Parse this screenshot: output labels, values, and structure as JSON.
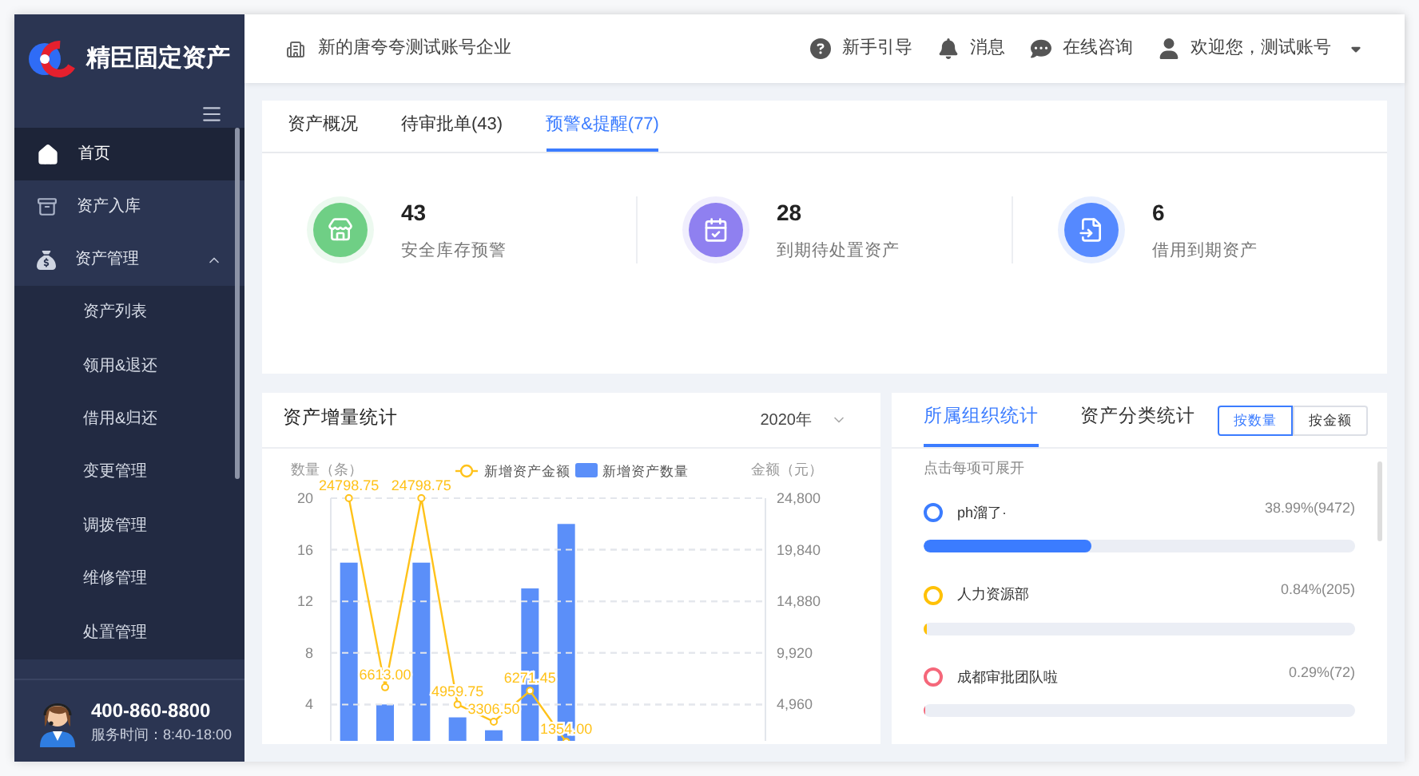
{
  "brand": {
    "name": "精臣固定资产"
  },
  "sidebar": {
    "items": [
      {
        "kind": "item",
        "label": "首页",
        "selected": true
      },
      {
        "kind": "item",
        "label": "资产入库",
        "selected": false
      },
      {
        "kind": "group",
        "label": "资产管理",
        "selected": false,
        "expanded": true,
        "children": [
          {
            "label": "资产列表",
            "selected": false
          },
          {
            "label": "领用&退还",
            "selected": false
          },
          {
            "label": "借用&归还",
            "selected": false
          },
          {
            "label": "变更管理",
            "selected": false
          },
          {
            "label": "调拨管理",
            "selected": false
          },
          {
            "label": "维修管理",
            "selected": false
          },
          {
            "label": "处置管理",
            "selected": false
          }
        ]
      }
    ],
    "support": {
      "phone": "400-860-8800",
      "hours": "服务时间：8:40-18:00"
    }
  },
  "header": {
    "company": "新的唐夸夸测试账号企业",
    "actions": [
      {
        "kind": "help",
        "label": "新手引导"
      },
      {
        "kind": "bell",
        "label": "消息"
      },
      {
        "kind": "chat",
        "label": "在线咨询"
      },
      {
        "kind": "user",
        "label": "欢迎您，测试账号"
      }
    ]
  },
  "tabs": [
    {
      "label": "资产概况",
      "selected": false
    },
    {
      "label": "待审批单(43)",
      "selected": false
    },
    {
      "label": "预警&提醒(77)",
      "selected": true
    }
  ],
  "stats": [
    {
      "kind": "stock",
      "value": "43",
      "label": "安全库存预警",
      "color": "#6fcf85"
    },
    {
      "kind": "calendar",
      "value": "28",
      "label": "到期待处置资产",
      "color": "#8f80f0"
    },
    {
      "kind": "borrow",
      "value": "6",
      "label": "借用到期资产",
      "color": "#5589ff"
    }
  ],
  "growth_panel": {
    "title": "资产增量统计",
    "year": "2020年",
    "layers": [
      {
        "chart_data": {
          "type": "bar",
          "categories": [
            null,
            null,
            null,
            null,
            null,
            null,
            null,
            null,
            null,
            null,
            null,
            null
          ],
          "ylabel": "数量（条）",
          "ylim": [
            0,
            20
          ],
          "yticks": [
            4,
            8,
            12,
            16,
            20
          ],
          "grid": true,
          "legend": "top",
          "series": [
            {
              "name": "新增资产数量",
              "color": "#5b8ff9",
              "values": [
                15,
                4,
                15,
                3,
                2,
                13,
                18,
                null,
                null,
                null,
                null,
                null
              ]
            }
          ]
        }
      },
      {
        "chart_data": {
          "type": "line",
          "categories": [
            null,
            null,
            null,
            null,
            null,
            null,
            null,
            null,
            null,
            null,
            null,
            null
          ],
          "ylabel": "金额（元）",
          "ylim": [
            0,
            24800
          ],
          "yticks": [
            {
              "value": 4960,
              "label": "4,960"
            },
            {
              "value": 9920,
              "label": "9,920"
            },
            {
              "value": 14880,
              "label": "14,880"
            },
            {
              "value": 19840,
              "label": "19,840"
            },
            {
              "value": 24800,
              "label": "24,800"
            }
          ],
          "grid": true,
          "legend": "top",
          "series": [
            {
              "name": "新增资产金额",
              "color": "#ffc21a",
              "marker": "circle",
              "values": [
                24798.75,
                6613.0,
                24798.75,
                4959.75,
                3306.5,
                6271.45,
                1354.0,
                null,
                null,
                null,
                null,
                null
              ],
              "value_labels": [
                "24798.75",
                "6613.00",
                "24798.75",
                "4959.75",
                "3306.50",
                "6271.45",
                "1354.00",
                null,
                null,
                null,
                null,
                null
              ]
            }
          ]
        }
      }
    ]
  },
  "org_panel": {
    "tabs": [
      {
        "label": "所属组织统计",
        "selected": true
      },
      {
        "label": "资产分类统计",
        "selected": false
      }
    ],
    "modes": [
      {
        "label": "按数量",
        "selected": true
      },
      {
        "label": "按金额",
        "selected": false
      }
    ],
    "hint": "点击每项可展开",
    "items": [
      {
        "name": "ph溜了·",
        "reading": "38.99%(9472)",
        "level": 0.3899,
        "color": "#3b7cff"
      },
      {
        "name": "人力资源部",
        "reading": "0.84%(205)",
        "level": 0.0084,
        "color": "#ffc107"
      },
      {
        "name": "成都审批团队啦",
        "reading": "0.29%(72)",
        "level": 0.0029,
        "color": "#f5677a"
      }
    ]
  }
}
